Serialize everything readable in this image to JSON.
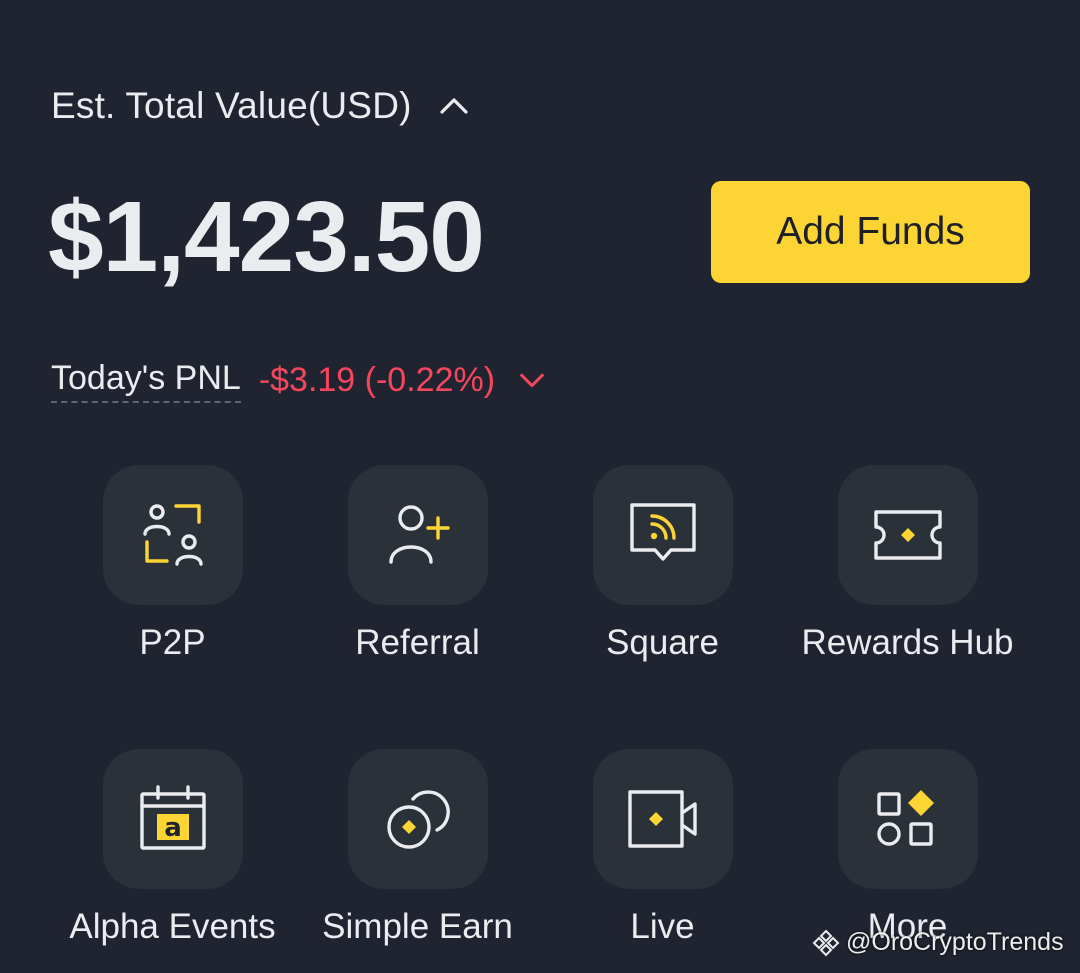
{
  "balance": {
    "label": "Est. Total Value(USD)",
    "total_value": "$1,423.50",
    "add_funds_label": "Add Funds",
    "pnl_label": "Today's PNL",
    "pnl_value": "-$3.19 (-0.22%)"
  },
  "shortcuts": [
    {
      "label": "P2P",
      "icon": "p2p-icon"
    },
    {
      "label": "Referral",
      "icon": "add-person-icon"
    },
    {
      "label": "Square",
      "icon": "feed-bubble-icon"
    },
    {
      "label": "Rewards Hub",
      "icon": "ticket-icon"
    },
    {
      "label": "Alpha Events",
      "icon": "calendar-alpha-icon"
    },
    {
      "label": "Simple Earn",
      "icon": "coins-icon"
    },
    {
      "label": "Live",
      "icon": "video-camera-icon"
    },
    {
      "label": "More",
      "icon": "grid-more-icon"
    }
  ],
  "watermark": {
    "text": "@OroCryptoTrends"
  },
  "colors": {
    "background": "#1f2430",
    "tile": "#2b3139",
    "accent_yellow": "#fcd535",
    "negative_red": "#f6465d",
    "text_primary": "#eaecef"
  }
}
